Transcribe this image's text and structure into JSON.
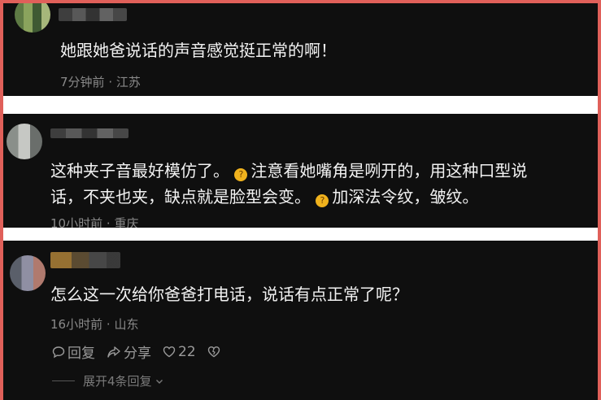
{
  "comments": [
    {
      "text": "她跟她爸说话的声音感觉挺正常的啊！",
      "time": "7分钟前",
      "location": "江苏",
      "avatar": "blurred-avatar",
      "username": "blurred-username"
    },
    {
      "line1_before": "这种夹子音最好模仿了。",
      "line1_after": "注意看她嘴角是咧开的，用这种口型说",
      "line2_before": "话，不夹也夹，缺点就是脸型会变。",
      "line2_after": "加深法令纹，皱纹。",
      "emoji": "thinking-face-emoji",
      "time": "10小时前",
      "location": "重庆",
      "avatar": "blurred-avatar",
      "username": "blurred-username"
    },
    {
      "text": "怎么这一次给你爸爸打电话，说话有点正常了呢？",
      "time": "16小时前",
      "location": "山东",
      "avatar": "blurred-avatar",
      "username": "blurred-username",
      "actions": {
        "reply": "回复",
        "share": "分享",
        "like_count": "22"
      },
      "expand_replies": "展开4条回复"
    }
  ],
  "separator": "·",
  "colors": {
    "frame": "#e0605a",
    "card_bg": "#0f0f0f",
    "text": "#f2f2f2",
    "meta": "#8a8a8a"
  }
}
